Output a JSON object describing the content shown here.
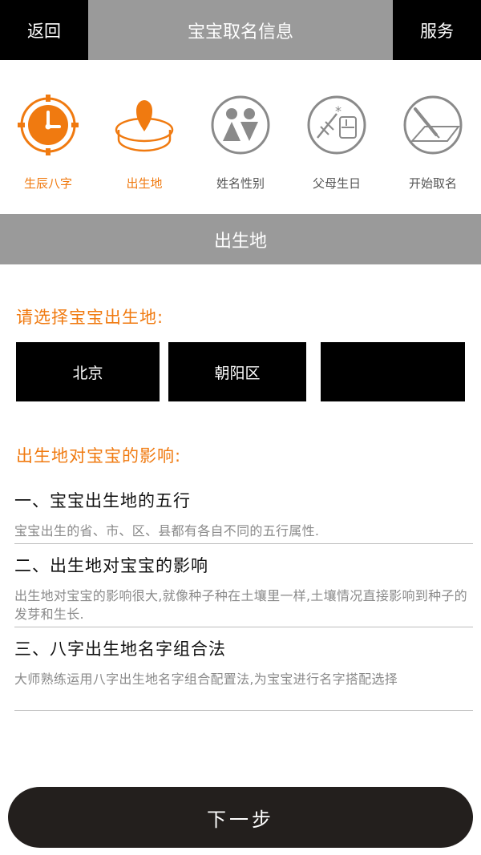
{
  "header": {
    "back_label": "返回",
    "title": "宝宝取名信息",
    "service_label": "服务"
  },
  "steps": [
    {
      "label": "生辰八字",
      "icon": "clock-icon",
      "active": true
    },
    {
      "label": "出生地",
      "icon": "location-pin-icon",
      "active": true
    },
    {
      "label": "姓名性别",
      "icon": "gender-icon",
      "active": false
    },
    {
      "label": "父母生日",
      "icon": "parents-birthday-icon",
      "active": false
    },
    {
      "label": "开始取名",
      "icon": "pen-paper-icon",
      "active": false
    }
  ],
  "section": {
    "title": "出生地"
  },
  "select": {
    "prompt": "请选择宝宝出生地:",
    "province": "北京",
    "district": "朝阳区",
    "third": ""
  },
  "influence": {
    "title": "出生地对宝宝的影响:",
    "items": [
      {
        "heading": "一、宝宝出生地的五行",
        "desc": "宝宝出生的省、市、区、县都有各自不同的五行属性."
      },
      {
        "heading": "二、出生地对宝宝的影响",
        "desc": "出生地对宝宝的影响很大,就像种子种在土壤里一样,土壤情况直接影响到种子的发芽和生长."
      },
      {
        "heading": "三、八字出生地名字组合法",
        "desc": "大师熟练运用八字出生地名字组合配置法,为宝宝进行名字搭配选择"
      }
    ]
  },
  "footer": {
    "next_label": "下一步"
  },
  "colors": {
    "accent": "#f07a10",
    "gray_bar": "#9a9a9a",
    "black": "#000000",
    "button": "#231f1d",
    "inactive_icon": "#8a8a8a"
  }
}
